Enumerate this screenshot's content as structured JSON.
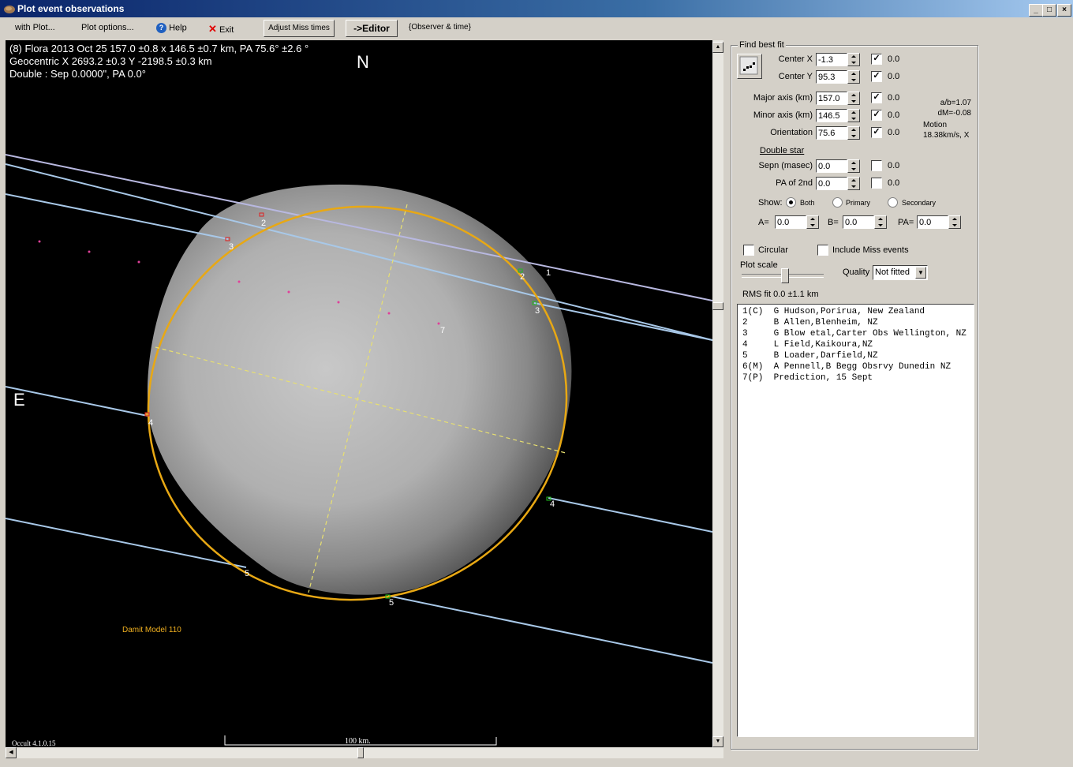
{
  "window": {
    "title": "Plot event observations",
    "controls": {
      "minimize": "_",
      "maximize": "□",
      "close": "×"
    }
  },
  "menu": {
    "with_plot": "with Plot...",
    "plot_options": "Plot options...",
    "help": "Help",
    "exit": "Exit",
    "adjust_miss_times": "Adjust Miss times",
    "editor": "->Editor",
    "observer_time": "{Observer & time}"
  },
  "plot": {
    "header_line1": "(8) Flora  2013 Oct 25   157.0 ±0.8 x 146.5 ±0.7 km, PA 75.6° ±2.6 °",
    "header_line2": "Geocentric X  2693.2 ±0.3  Y -2198.5 ±0.3 km",
    "header_line3": "Double : Sep  0.0000\", PA 0.0°",
    "north_label": "N",
    "east_label": "E",
    "model_label": "Damit Model 110",
    "version_label": "Occult 4.1.0.15",
    "scale_label": "100 km.",
    "chord_labels": [
      "1",
      "2",
      "3",
      "4",
      "5",
      "2",
      "3",
      "4",
      "5",
      "7"
    ],
    "colors": {
      "background": "#000000",
      "ellipse": "#e8a814",
      "chord": "#a8c8e8",
      "chord_alt": "#b8b8e0",
      "disappear": "#e02020",
      "reappear": "#20c020",
      "model_text": "#f0b020",
      "axis": "#e8e070",
      "prediction": "#e0409a"
    }
  },
  "fit_panel": {
    "group_title": "Find best fit",
    "center_x": {
      "label": "Center X",
      "value": "-1.3",
      "checked": true,
      "delta": "0.0"
    },
    "center_y": {
      "label": "Center Y",
      "value": "95.3",
      "checked": true,
      "delta": "0.0"
    },
    "major_axis": {
      "label": "Major axis (km)",
      "value": "157.0",
      "checked": true,
      "delta": "0.0"
    },
    "minor_axis": {
      "label": "Minor axis (km)",
      "value": "146.5",
      "checked": true,
      "delta": "0.0"
    },
    "orientation": {
      "label": "Orientation",
      "value": "75.6",
      "checked": true,
      "delta": "0.0"
    },
    "ab_ratio": "a/b=1.07",
    "dm": "dM=-0.08",
    "motion_label": "Motion",
    "motion_value": "18.38km/s, X",
    "double_star": {
      "title": "Double star",
      "sepn": {
        "label": "Sepn (masec)",
        "value": "0.0",
        "checked": false,
        "delta": "0.0"
      },
      "pa2nd": {
        "label": "PA of 2nd",
        "value": "0.0",
        "checked": false,
        "delta": "0.0"
      },
      "show_label": "Show:",
      "show_options": [
        "Both",
        "Primary",
        "Secondary"
      ],
      "show_selected": "Both",
      "a_label": "A=",
      "a_value": "0.0",
      "b_label": "B=",
      "b_value": "0.0",
      "pa_label": "PA=",
      "pa_value": "0.0"
    },
    "circular": {
      "label": "Circular",
      "checked": false
    },
    "include_miss": {
      "label": "Include Miss events",
      "checked": false
    },
    "plot_scale_label": "Plot scale",
    "quality_label": "Quality",
    "quality_value": "Not fitted",
    "rms_fit": "RMS fit 0.0 ±1.1 km",
    "observers": [
      "1(C)  G Hudson,Porirua, New Zealand",
      "2     B Allen,Blenheim, NZ",
      "3     G Blow etal,Carter Obs Wellington, NZ",
      "4     L Field,Kaikoura,NZ",
      "5     B Loader,Darfield,NZ",
      "6(M)  A Pennell,B Begg Obsrvy Dunedin NZ",
      "7(P)  Prediction, 15 Sept"
    ]
  }
}
